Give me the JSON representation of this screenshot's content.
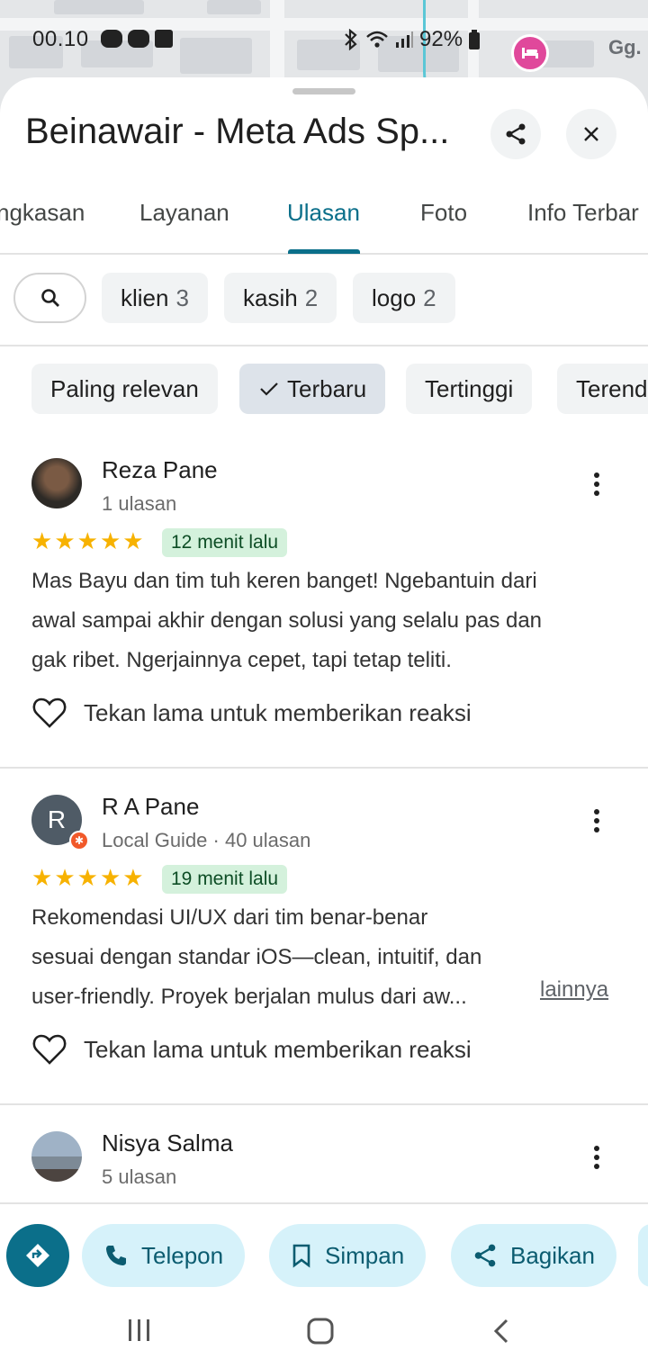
{
  "status_bar": {
    "time": "00.10",
    "battery": "92%"
  },
  "map": {
    "street_label": "Gg."
  },
  "sheet": {
    "title": "Beinawair - Meta Ads Sp..."
  },
  "tabs": [
    {
      "label": "ngkasan"
    },
    {
      "label": "Layanan"
    },
    {
      "label": "Ulasan"
    },
    {
      "label": "Foto"
    },
    {
      "label": "Info Terbar"
    }
  ],
  "keyword_chips": [
    {
      "label": "klien",
      "count": "3"
    },
    {
      "label": "kasih",
      "count": "2"
    },
    {
      "label": "logo",
      "count": "2"
    }
  ],
  "sort_chips": [
    {
      "label": "Paling relevan"
    },
    {
      "label": "Terbaru"
    },
    {
      "label": "Tertinggi"
    },
    {
      "label": "Terend"
    }
  ],
  "reviews": [
    {
      "name": "Reza Pane",
      "sub": "1 ulasan",
      "rating": 5,
      "time": "12 menit lalu",
      "lines": [
        "Mas Bayu dan tim tuh keren banget! Ngebantuin dari",
        "awal sampai akhir dengan solusi yang selalu pas dan",
        "gak ribet. Ngerjainnya cepet, tapi tetap teliti."
      ],
      "react": "Tekan lama untuk memberikan reaksi"
    },
    {
      "name": "R A Pane",
      "initial": "R",
      "sub": "Local Guide · 40 ulasan",
      "rating": 5,
      "time": "19 menit lalu",
      "lines": [
        "Rekomendasi UI/UX dari tim benar-benar",
        "sesuai dengan standar iOS—clean, intuitif, dan",
        "user-friendly. Proyek berjalan mulus dari aw..."
      ],
      "more": "lainnya",
      "react": "Tekan lama untuk memberikan reaksi"
    },
    {
      "name": "Nisya Salma",
      "sub": "5 ulasan"
    }
  ],
  "actions": {
    "telepon": "Telepon",
    "simpan": "Simpan",
    "bagikan": "Bagikan"
  },
  "colors": {
    "accent": "#0b6f8a",
    "chip_bg": "#d6f2fa",
    "star": "#f7b201",
    "time_badge": "#d4f1dc"
  }
}
